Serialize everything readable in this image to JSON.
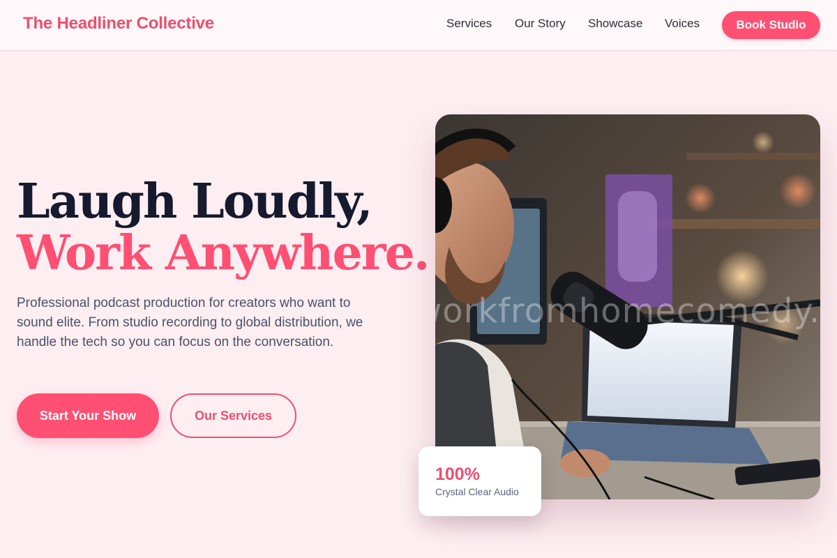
{
  "header": {
    "brand": "The Headliner Collective",
    "nav": [
      "Services",
      "Our Story",
      "Showcase",
      "Voices"
    ],
    "cta": "Book Studio"
  },
  "hero": {
    "headline_line1": "Laugh Loudly,",
    "headline_line2": "Work Anywhere.",
    "description": "Professional podcast production for creators who want to sound elite. From studio recording to global distribution, we handle the tech so you can focus on the conversation.",
    "primary_button": "Start Your Show",
    "secondary_button": "Our Services",
    "image_alt": "Podcaster wearing headphones speaking into a microphone in a home studio",
    "image_watermark": "workfromhomecomedy.com",
    "stat": {
      "value": "100%",
      "label": "Crystal Clear Audio"
    }
  },
  "colors": {
    "accent": "#ff4f72",
    "brand_text": "#ee4e6e",
    "headline_dark": "#161a2e",
    "page_background": "#fdeef2"
  }
}
